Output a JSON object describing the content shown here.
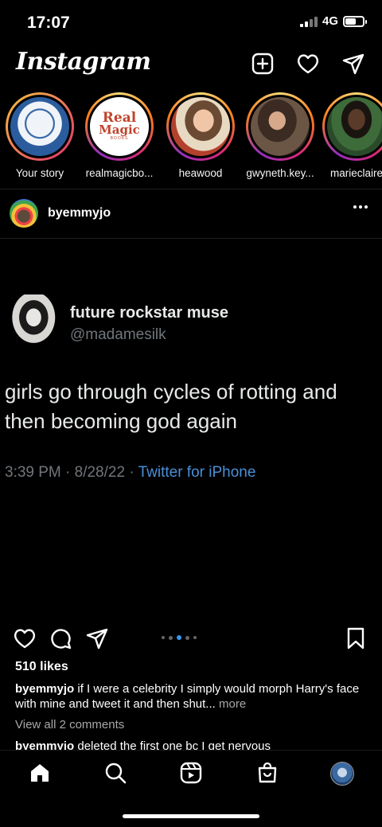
{
  "status": {
    "time": "17:07",
    "network": "4G",
    "battery_level": 0.6
  },
  "header": {
    "logo": "Instagram",
    "icons": [
      "add-post-icon",
      "heart-icon",
      "send-icon"
    ]
  },
  "stories": [
    {
      "label": "Your story",
      "ring": "none"
    },
    {
      "label": "realmagicbo...",
      "ring": "active",
      "logo_line1": "Real",
      "logo_line2": "Magic",
      "logo_line3": "BOOKS"
    },
    {
      "label": "heawood",
      "ring": "active"
    },
    {
      "label": "gwyneth.key...",
      "ring": "active"
    },
    {
      "label": "marieclaire",
      "ring": "active"
    }
  ],
  "post": {
    "username": "byemmyjo",
    "tweet": {
      "name": "future rockstar muse",
      "handle": "@madamesilk",
      "text": "girls go through cycles of rotting and then becoming god again",
      "time": "3:39 PM · 8/28/22 · ",
      "source": "Twitter for iPhone"
    },
    "carousel": {
      "count": 5,
      "active_index": 2
    },
    "likes": "510 likes",
    "caption_user": "byemmyjo",
    "caption_text": " if I were a celebrity I simply would morph Harry's face with mine and tweet it and then shut...",
    "caption_more": " more",
    "view_comments": "View all 2 comments",
    "comment_user": "byemmyjo",
    "comment_text": " deleted the first one bc I get nervous"
  },
  "nav": {
    "items": [
      "home-icon",
      "search-icon",
      "reels-icon",
      "shop-icon",
      "profile-avatar"
    ]
  },
  "colors": {
    "background": "#000000",
    "link": "#4a8fd8",
    "muted": "#71767b",
    "story_gradient": [
      "#feda75",
      "#fa7e1e",
      "#d62976",
      "#962fbf"
    ]
  }
}
